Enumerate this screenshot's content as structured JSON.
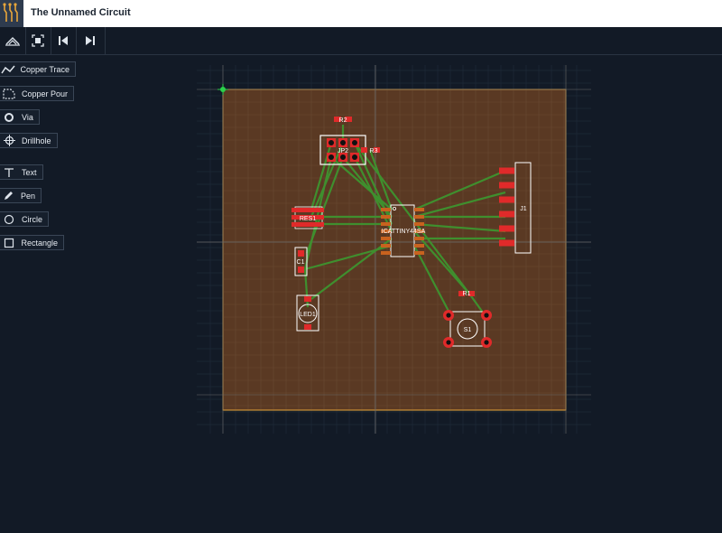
{
  "app": {
    "title": "The Unnamed Circuit"
  },
  "toolbar": {
    "buttons": [
      "layers-icon",
      "fit-view-icon",
      "skip-back-icon",
      "skip-forward-icon"
    ]
  },
  "tools": [
    {
      "label": "Copper Trace",
      "icon": "copper-trace-icon"
    },
    {
      "label": "Copper Pour",
      "icon": "copper-pour-icon"
    },
    {
      "label": "Via",
      "icon": "via-icon"
    },
    {
      "label": "Drillhole",
      "icon": "drillhole-icon"
    },
    {
      "label": "Text",
      "icon": "text-icon"
    },
    {
      "label": "Pen",
      "icon": "pen-icon"
    },
    {
      "label": "Circle",
      "icon": "circle-icon"
    },
    {
      "label": "Rectangle",
      "icon": "rectangle-icon"
    }
  ],
  "board": {
    "colors": {
      "board": "#5a3923",
      "outline": "#e8a63a",
      "pad": "#e02a2a",
      "trace": "#3f8f2e",
      "silk": "#ffffff",
      "origin": "#2bd14b"
    },
    "components": {
      "r2": "R2",
      "jp2": "JP2",
      "r3": "R3",
      "j1": "J1",
      "res1": "RES1",
      "u1": "ICATTINY44SA",
      "c1": "C1",
      "led1": "LED1",
      "r1": "R1",
      "s1": "S1"
    }
  }
}
